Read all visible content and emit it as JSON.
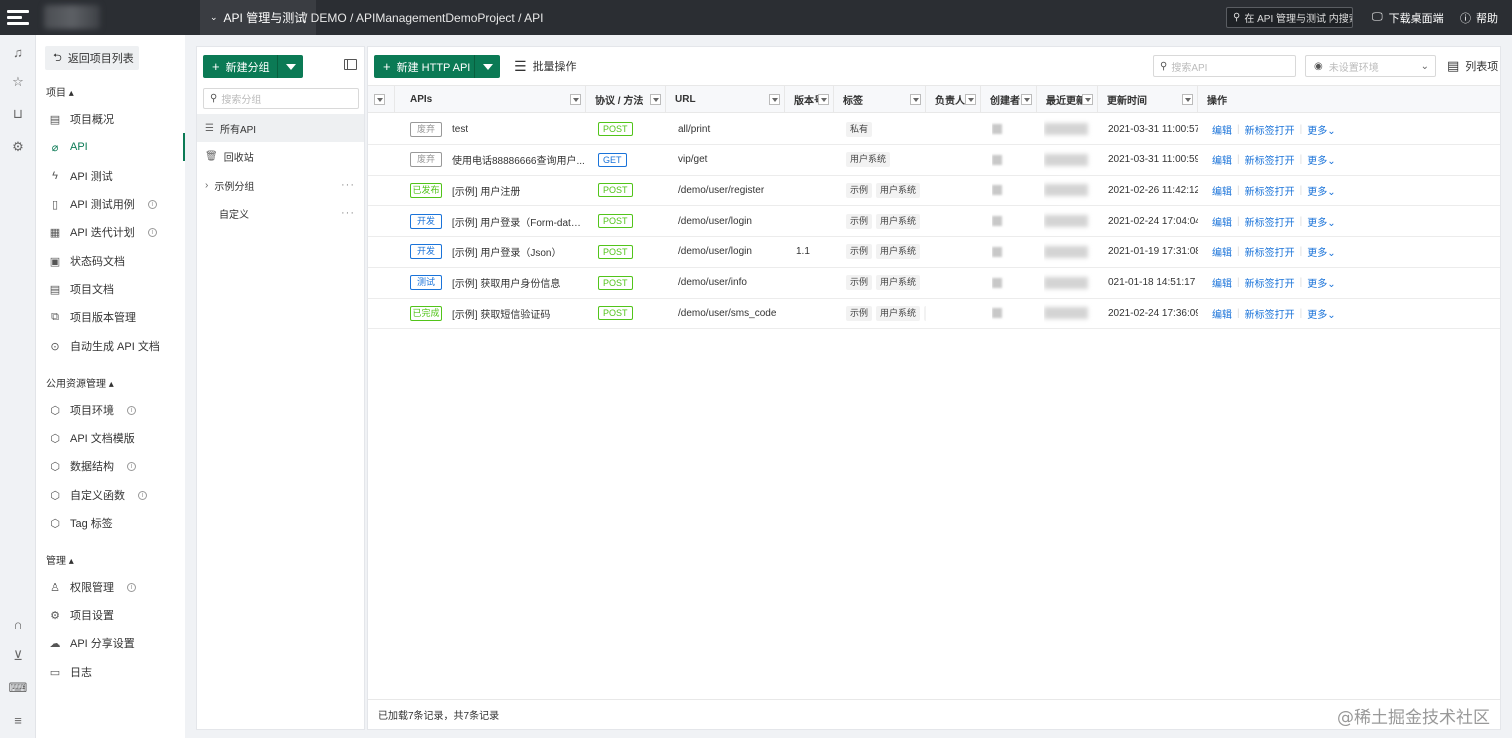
{
  "topbar": {
    "active_crumb": "API 管理与测试",
    "path": "/ DEMO / APIManagementDemoProject / API",
    "search_placeholder": "在 API 管理与测试 内搜索",
    "download_label": "下载桌面端",
    "help_label": "帮助"
  },
  "nav": {
    "back_label": "返回项目列表",
    "sections": {
      "project": "项目",
      "public": "公用资源管理",
      "manage": "管理"
    },
    "project_items": [
      {
        "label": "项目概况",
        "icon": "document-icon"
      },
      {
        "label": "API",
        "icon": "api-icon",
        "active": true
      },
      {
        "label": "API 测试",
        "icon": "lightning-icon"
      },
      {
        "label": "API 测试用例",
        "icon": "testcase-icon",
        "info": true
      },
      {
        "label": "API 迭代计划",
        "icon": "plan-icon",
        "info": true
      },
      {
        "label": "状态码文档",
        "icon": "statuscode-icon"
      },
      {
        "label": "项目文档",
        "icon": "doc-icon"
      },
      {
        "label": "项目版本管理",
        "icon": "version-icon"
      },
      {
        "label": "自动生成 API 文档",
        "icon": "robot-icon"
      }
    ],
    "public_items": [
      {
        "label": "项目环境",
        "icon": "cube-icon",
        "info": true
      },
      {
        "label": "API 文档模版",
        "icon": "cube-icon"
      },
      {
        "label": "数据结构",
        "icon": "cube-icon",
        "info": true
      },
      {
        "label": "自定义函数",
        "icon": "cube-icon",
        "info": true
      },
      {
        "label": "Tag 标签",
        "icon": "cube-icon"
      }
    ],
    "manage_items": [
      {
        "label": "权限管理",
        "icon": "user-icon",
        "info": true
      },
      {
        "label": "项目设置",
        "icon": "gear-icon"
      },
      {
        "label": "API 分享设置",
        "icon": "cloud-icon"
      },
      {
        "label": "日志",
        "icon": "log-icon"
      }
    ]
  },
  "groups": {
    "new_group_label": "新建分组",
    "search_placeholder": "搜索分组",
    "items": [
      "所有API",
      "回收站",
      "示例分组",
      "自定义"
    ]
  },
  "main": {
    "new_api_label": "新建 HTTP API",
    "batch_label": "批量操作",
    "search_placeholder": "搜索API",
    "env_placeholder": "未设置环境",
    "columns_label": "列表项",
    "headers": [
      "APIs",
      "协议 / 方法",
      "URL",
      "版本号",
      "标签",
      "负责人",
      "创建者",
      "最近更新",
      "更新时间",
      "操作"
    ],
    "rows": [
      {
        "status": "废弃",
        "status_color": "#999999",
        "name": "test",
        "method": "POST",
        "url": "all/print",
        "version": "",
        "tags": [
          "私有"
        ],
        "time": "2021-03-31 11:00:57"
      },
      {
        "status": "废弃",
        "status_color": "#999999",
        "name": "使用电话88886666查询用户...",
        "method": "GET",
        "url": "vip/get",
        "version": "",
        "tags": [
          "用户系统"
        ],
        "time": "2021-03-31 11:00:59"
      },
      {
        "status": "已发布",
        "status_color": "#52c41a",
        "name": "[示例] 用户注册",
        "method": "POST",
        "url": "/demo/user/register",
        "version": "",
        "tags": [
          "示例",
          "用户系统"
        ],
        "time": "2021-02-26 11:42:12"
      },
      {
        "status": "开发",
        "status_color": "#1a73d9",
        "name": "[示例] 用户登录（Form-data）",
        "method": "POST",
        "url": "/demo/user/login",
        "version": "",
        "tags": [
          "示例",
          "用户系统"
        ],
        "time": "2021-02-24 17:04:04"
      },
      {
        "status": "开发",
        "status_color": "#1a73d9",
        "name": "[示例] 用户登录（Json）",
        "method": "POST",
        "url": "/demo/user/login",
        "version": "1.1",
        "tags": [
          "示例",
          "用户系统"
        ],
        "time": "2021-01-19 17:31:08"
      },
      {
        "status": "测试",
        "status_color": "#1a73d9",
        "name": "[示例] 获取用户身份信息",
        "method": "POST",
        "url": "/demo/user/info",
        "version": "",
        "tags": [
          "示例",
          "用户系统"
        ],
        "time": "021-01-18 14:51:17"
      },
      {
        "status": "已完成",
        "status_color": "#52c41a",
        "name": "[示例] 获取短信验证码",
        "method": "POST",
        "url": "/demo/user/sms_code",
        "version": "",
        "tags": [
          "示例",
          "用户系统",
          "..."
        ],
        "time": "2021-02-24 17:36:09"
      }
    ],
    "ops": {
      "edit": "编辑",
      "new_tab": "新标签打开",
      "more": "更多"
    },
    "footer": "已加载7条记录，共7条记录",
    "watermark": "@稀土掘金技术社区"
  },
  "colors": {
    "accent": "#0b7a55",
    "link": "#1a73d9",
    "post": "#52c41a",
    "get": "#1a73d9",
    "topbar": "#2b2e33"
  }
}
